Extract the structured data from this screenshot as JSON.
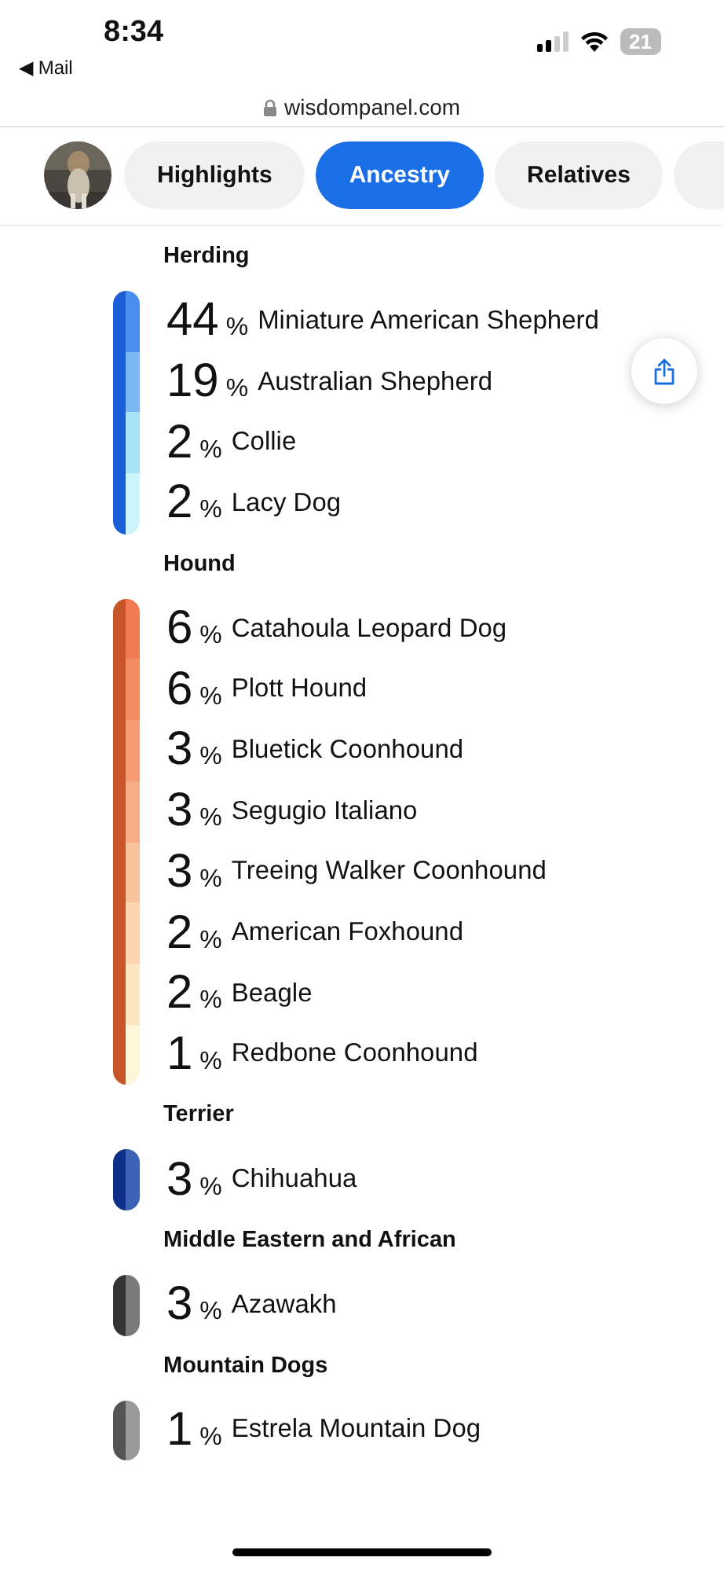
{
  "status_bar": {
    "time": "8:34",
    "back_label": "◀ Mail",
    "battery": "21"
  },
  "address_bar": {
    "url": "wisdompanel.com"
  },
  "tabs": [
    {
      "label": "Highlights",
      "selected": false
    },
    {
      "label": "Ancestry",
      "selected": true
    },
    {
      "label": "Relatives",
      "selected": false
    }
  ],
  "groups": [
    {
      "name": "Herding",
      "color": "#1a5fd6",
      "breeds": [
        {
          "percent": "44",
          "unit": "%",
          "name": "Miniature American Shepherd",
          "color": "#4a8ef0"
        },
        {
          "percent": "19",
          "unit": "%",
          "name": "Australian Shepherd",
          "color": "#7ab8f5"
        },
        {
          "percent": "2",
          "unit": "%",
          "name": "Collie",
          "color": "#a8e4f8"
        },
        {
          "percent": "2",
          "unit": "%",
          "name": "Lacy Dog",
          "color": "#cbf5fa"
        }
      ]
    },
    {
      "name": "Hound",
      "color": "#c8542a",
      "breeds": [
        {
          "percent": "6",
          "unit": "%",
          "name": "Catahoula Leopard Dog",
          "color": "#f07a52"
        },
        {
          "percent": "6",
          "unit": "%",
          "name": "Plott Hound",
          "color": "#f48c62"
        },
        {
          "percent": "3",
          "unit": "%",
          "name": "Bluetick Coonhound",
          "color": "#f59c72"
        },
        {
          "percent": "3",
          "unit": "%",
          "name": "Segugio Italiano",
          "color": "#f7ae86"
        },
        {
          "percent": "3",
          "unit": "%",
          "name": "Treeing Walker Coonhound",
          "color": "#f8c29a"
        },
        {
          "percent": "2",
          "unit": "%",
          "name": "American Foxhound",
          "color": "#fad5ae"
        },
        {
          "percent": "2",
          "unit": "%",
          "name": "Beagle",
          "color": "#fce6c2"
        },
        {
          "percent": "1",
          "unit": "%",
          "name": "Redbone Coonhound",
          "color": "#fdf6d8"
        }
      ]
    },
    {
      "name": "Terrier",
      "color": "#0d2f8a",
      "breeds": [
        {
          "percent": "3",
          "unit": "%",
          "name": "Chihuahua",
          "color": "#3b62b4"
        }
      ]
    },
    {
      "name": "Middle Eastern and African",
      "color": "#333333",
      "breeds": [
        {
          "percent": "3",
          "unit": "%",
          "name": "Azawakh",
          "color": "#7a7a7a"
        }
      ]
    },
    {
      "name": "Mountain Dogs",
      "color": "#555555",
      "breeds": [
        {
          "percent": "1",
          "unit": "%",
          "name": "Estrela Mountain Dog",
          "color": "#9a9a9a"
        }
      ]
    }
  ]
}
